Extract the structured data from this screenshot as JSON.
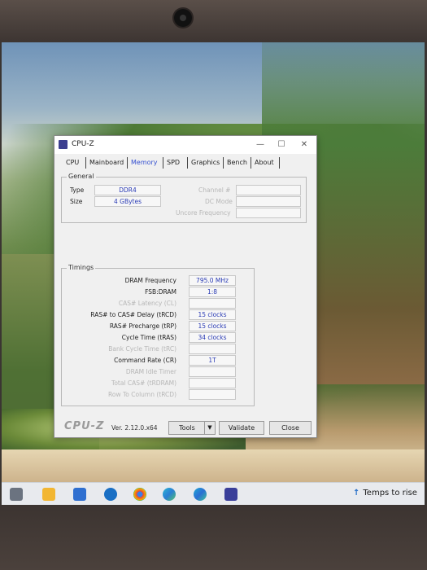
{
  "window": {
    "title": "CPU-Z",
    "minimize_glyph": "—",
    "maximize_glyph": "☐",
    "close_glyph": "✕"
  },
  "tabs": [
    {
      "label": "CPU"
    },
    {
      "label": "Mainboard"
    },
    {
      "label": "Memory",
      "active": true
    },
    {
      "label": "SPD"
    },
    {
      "label": "Graphics"
    },
    {
      "label": "Bench"
    },
    {
      "label": "About"
    }
  ],
  "general": {
    "title": "General",
    "type_label": "Type",
    "type_value": "DDR4",
    "size_label": "Size",
    "size_value": "4 GBytes",
    "channel_label": "Channel #",
    "channel_value": "",
    "dc_mode_label": "DC Mode",
    "dc_mode_value": "",
    "uncore_label": "Uncore Frequency",
    "uncore_value": ""
  },
  "timings": {
    "title": "Timings",
    "rows": [
      {
        "label": "DRAM Frequency",
        "value": "795.0 MHz",
        "dim": false
      },
      {
        "label": "FSB:DRAM",
        "value": "1:8",
        "dim": false
      },
      {
        "label": "CAS# Latency (CL)",
        "value": "",
        "dim": true
      },
      {
        "label": "RAS# to CAS# Delay (tRCD)",
        "value": "15 clocks",
        "dim": false
      },
      {
        "label": "RAS# Precharge (tRP)",
        "value": "15 clocks",
        "dim": false
      },
      {
        "label": "Cycle Time (tRAS)",
        "value": "34 clocks",
        "dim": false
      },
      {
        "label": "Bank Cycle Time (tRC)",
        "value": "",
        "dim": true
      },
      {
        "label": "Command Rate (CR)",
        "value": "1T",
        "dim": false
      },
      {
        "label": "DRAM Idle Timer",
        "value": "",
        "dim": true
      },
      {
        "label": "Total CAS# (tRDRAM)",
        "value": "",
        "dim": true
      },
      {
        "label": "Row To Column (tRCD)",
        "value": "",
        "dim": true
      }
    ]
  },
  "footer": {
    "logo": "CPU-Z",
    "version": "Ver. 2.12.0.x64",
    "tools_label": "Tools",
    "tools_arrow": "▼",
    "validate_label": "Validate",
    "close_label": "Close"
  },
  "taskbar": {
    "tray_arrow": "↑",
    "tray_text": "Temps to rise",
    "icons": [
      "task-view-icon",
      "file-explorer-icon",
      "store-icon",
      "outlook-icon",
      "chrome-icon",
      "edge-icon",
      "edge-beta-icon",
      "cpuz-taskbar-icon"
    ]
  },
  "colors": {
    "value_text": "#2a3bb5",
    "active_tab": "#3550d0",
    "disabled_label": "#b7b7b7"
  }
}
